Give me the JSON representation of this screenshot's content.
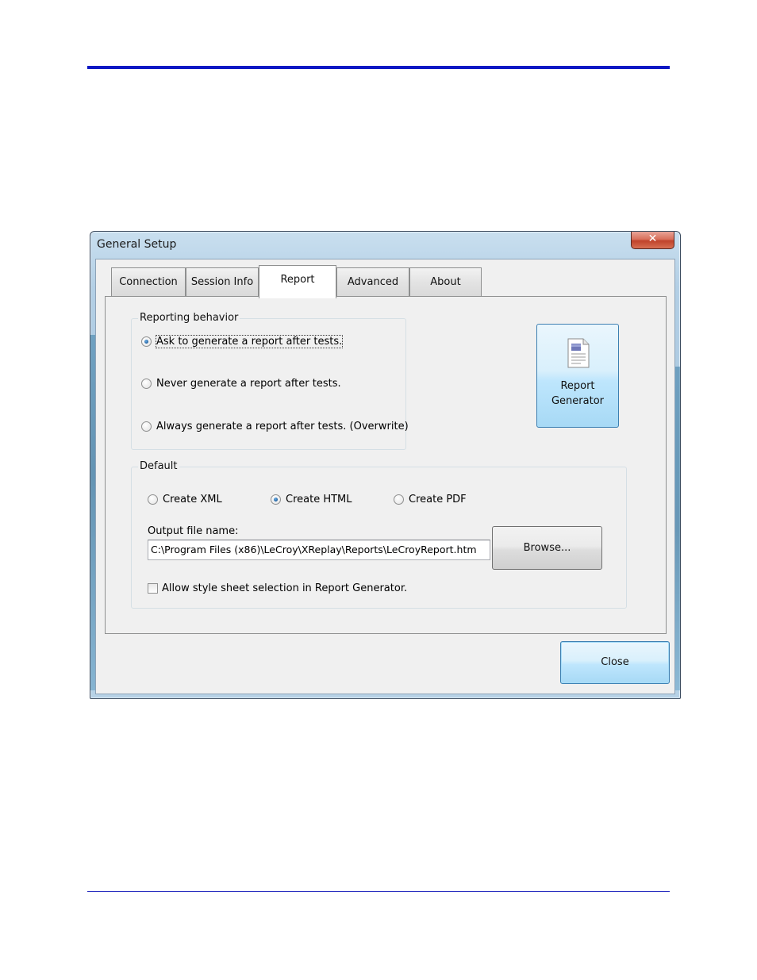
{
  "window": {
    "title": "General Setup",
    "close_glyph": "✕"
  },
  "tabs": [
    {
      "label": "Connection"
    },
    {
      "label": "Session Info"
    },
    {
      "label": "Report",
      "selected": true
    },
    {
      "label": "Advanced"
    },
    {
      "label": "About"
    }
  ],
  "reporting": {
    "group_label": "Reporting behavior",
    "options": [
      {
        "label": "Ask to generate a report after tests.",
        "selected": true
      },
      {
        "label": "Never generate a report after tests.",
        "selected": false
      },
      {
        "label": "Always generate a report after tests. (Overwrite)",
        "selected": false
      }
    ]
  },
  "report_generator": {
    "label_line1": "Report",
    "label_line2": "Generator",
    "icon": "document-icon"
  },
  "default": {
    "group_label": "Default",
    "formats": [
      {
        "label": "Create XML",
        "selected": false
      },
      {
        "label": "Create HTML",
        "selected": true
      },
      {
        "label": "Create PDF",
        "selected": false
      }
    ],
    "output_label": "Output file name:",
    "output_value": "C:\\Program Files (x86)\\LeCroy\\XReplay\\Reports\\LeCroyReport.htm",
    "browse_label": "Browse...",
    "stylesheet_label": "Allow style sheet selection in Report Generator.",
    "stylesheet_checked": false
  },
  "footer": {
    "close_label": "Close"
  },
  "colors": {
    "page_rule": "#0c18c4",
    "accent_button": "#3c7fb1"
  }
}
